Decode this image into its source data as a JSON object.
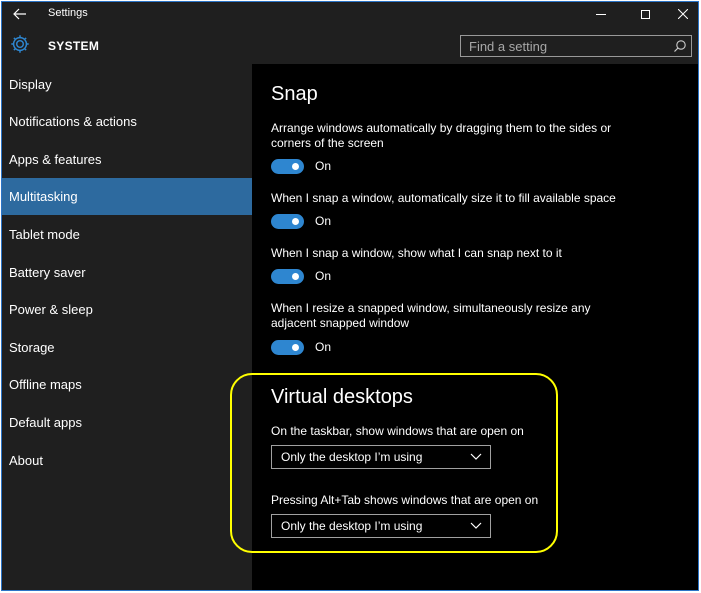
{
  "window": {
    "title": "Settings",
    "back_icon": "arrow-left-icon",
    "controls": [
      "minimize-icon",
      "maximize-icon",
      "close-icon"
    ]
  },
  "header": {
    "icon": "gear-icon",
    "title": "SYSTEM",
    "search_placeholder": "Find a setting",
    "search_icon": "search-icon"
  },
  "sidebar": {
    "items": [
      {
        "label": "Display"
      },
      {
        "label": "Notifications & actions"
      },
      {
        "label": "Apps & features"
      },
      {
        "label": "Multitasking",
        "selected": true
      },
      {
        "label": "Tablet mode"
      },
      {
        "label": "Battery saver"
      },
      {
        "label": "Power & sleep"
      },
      {
        "label": "Storage"
      },
      {
        "label": "Offline maps"
      },
      {
        "label": "Default apps"
      },
      {
        "label": "About"
      }
    ]
  },
  "snap": {
    "title": "Snap",
    "settings": [
      {
        "text": "Arrange windows automatically by dragging them to the sides or corners of the screen",
        "state": "On"
      },
      {
        "text": "When I snap a window, automatically size it to fill available space",
        "state": "On"
      },
      {
        "text": "When I snap a window, show what I can snap next to it",
        "state": "On"
      },
      {
        "text": "When I resize a snapped window, simultaneously resize any adjacent snapped window",
        "state": "On"
      }
    ]
  },
  "virtual_desktops": {
    "title": "Virtual desktops",
    "taskbar_label": "On the taskbar, show windows that are open on",
    "taskbar_value": "Only the desktop I’m using",
    "alttab_label": "Pressing Alt+Tab shows windows that are open on",
    "alttab_value": "Only the desktop I’m using"
  },
  "colors": {
    "accent": "#2e86d0",
    "selected_nav": "#2d6a9f",
    "highlight_ring": "#ffff00"
  }
}
